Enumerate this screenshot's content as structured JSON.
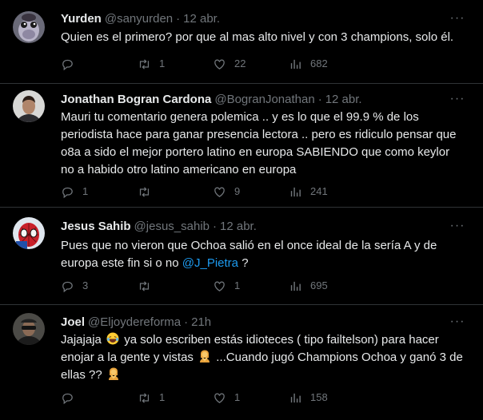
{
  "colors": {
    "background": "#000000",
    "text": "#e7e9ea",
    "muted": "#71767b",
    "link": "#1d9bf0",
    "divider": "#2f3336"
  },
  "icons": {
    "reply": "reply-icon",
    "retweet": "retweet-icon",
    "like": "heart-icon",
    "views": "views-icon",
    "more": "more-icon"
  },
  "tweets": [
    {
      "name": "Yurden",
      "handle": "@sanyurden",
      "date": "12 abr.",
      "text": "Quien es el primero? por que al mas alto nivel y con 3 champions, solo él.",
      "replies": "",
      "retweets": "1",
      "likes": "22",
      "views": "682"
    },
    {
      "name": "Jonathan Bogran Cardona",
      "handle": "@BogranJonathan",
      "date": "12 abr.",
      "text": "Mauri tu comentario genera polemica .. y es lo que el 99.9 % de los periodista hace para ganar presencia lectora .. pero es ridiculo pensar que o8a a sido el mejor portero latino en europa SABIENDO que como keylor no a habido otro latino americano en europa",
      "replies": "1",
      "retweets": "",
      "likes": "9",
      "views": "241"
    },
    {
      "name": "Jesus Sahib",
      "handle": "@jesus_sahib",
      "date": "12 abr.",
      "text_before": "Pues que no vieron que Ochoa salió en el once ideal de la sería A y de europa este fin si o no ",
      "mention": "@J_Pietra",
      "text_after": " ?",
      "replies": "3",
      "retweets": "",
      "likes": "1",
      "views": "695"
    },
    {
      "name": "Joel",
      "handle": "@Eljoydereforma",
      "date": "21h",
      "text_part1": "Jajajaja ",
      "text_part2": " ya solo escriben estás idioteces ( tipo failtelson) para hacer enojar a la gente y vistas ",
      "text_part3": " ...Cuando jugó Champions Ochoa y ganó 3 de ellas ?? ",
      "emojis": [
        "laughing-emoji",
        "person-gesturing-emoji",
        "person-gesturing-emoji"
      ],
      "replies": "",
      "retweets": "1",
      "likes": "1",
      "views": "158"
    }
  ]
}
